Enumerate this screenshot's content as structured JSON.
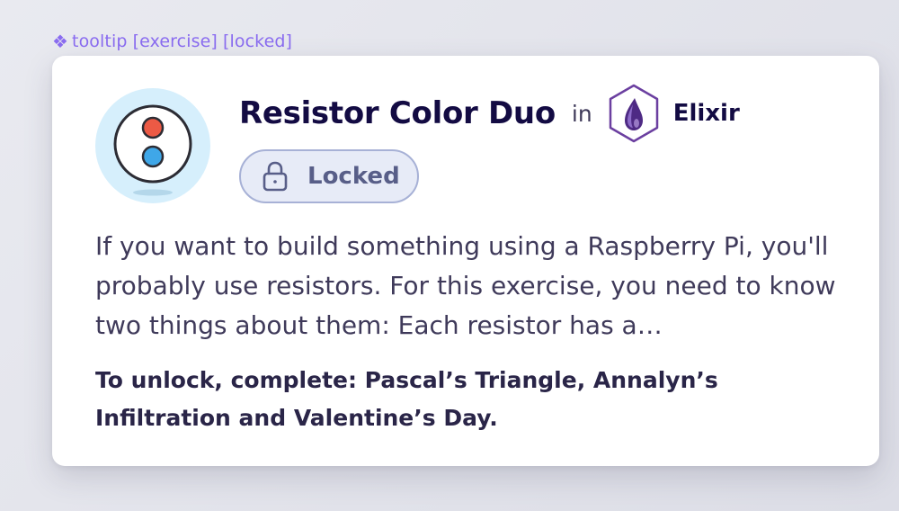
{
  "component_label": {
    "icon": "component-diamond-icon",
    "text": "tooltip [exercise] [locked]",
    "color": "#8a6cf0"
  },
  "tooltip": {
    "exercise_icon": "resistor-icon",
    "title": "Resistor Color Duo",
    "in_word": "in",
    "track": {
      "icon": "elixir-track-icon",
      "name": "Elixir"
    },
    "status_badge": {
      "icon": "lock-icon",
      "label": "Locked"
    },
    "description": "If you want to build something using a Raspberry Pi, you'll probably use resistors. For this exercise, you need to know two things about them: Each resistor has a…",
    "unlock_text": "To unlock, complete: Pascal’s Triangle, Annalyn’s Infiltration and Valentine’s Day."
  },
  "colors": {
    "title": "#130b43",
    "badge_border": "#a7b1d6",
    "badge_background": "#e7ebf7",
    "icon_background": "#d6effc",
    "resistor_red": "#ec5a45",
    "resistor_blue": "#3fa7e8",
    "elixir_purple": "#6b3fa0"
  }
}
